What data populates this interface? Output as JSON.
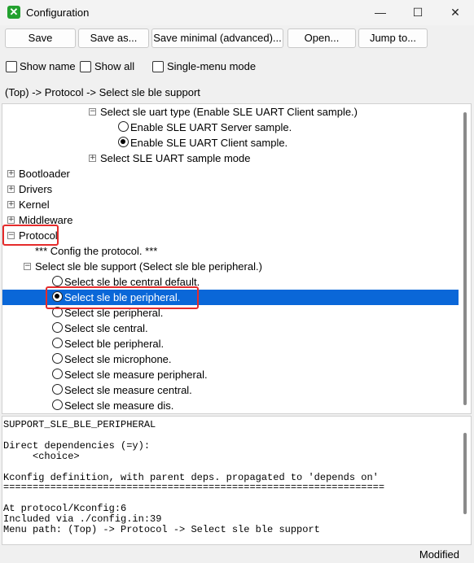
{
  "window": {
    "title": "Configuration",
    "icon": "checkmark-x-icon",
    "minimize": "—",
    "maximize": "☐",
    "close": "✕"
  },
  "toolbar": {
    "save": "Save",
    "save_as": "Save as...",
    "save_minimal": "Save minimal (advanced)...",
    "open": "Open...",
    "jump_to": "Jump to..."
  },
  "options": {
    "show_name": "Show name",
    "show_all": "Show all",
    "single_menu": "Single-menu mode"
  },
  "breadcrumb": "(Top) -> Protocol -> Select sle ble support",
  "tree": [
    {
      "label": "Select sle uart type (Enable SLE UART Client sample.)",
      "kind": "expander",
      "expanded": true
    },
    {
      "label": "Enable SLE UART Server sample.",
      "kind": "radio",
      "checked": false
    },
    {
      "label": "Enable SLE UART Client sample.",
      "kind": "radio",
      "checked": true
    },
    {
      "label": "Select SLE UART sample mode",
      "kind": "expander",
      "expanded": false
    },
    {
      "label": "Bootloader",
      "kind": "expander",
      "expanded": false
    },
    {
      "label": "Drivers",
      "kind": "expander",
      "expanded": false
    },
    {
      "label": "Kernel",
      "kind": "expander",
      "expanded": false
    },
    {
      "label": "Middleware",
      "kind": "expander",
      "expanded": false
    },
    {
      "label": "Protocol",
      "kind": "expander",
      "expanded": true
    },
    {
      "label": "*** Config the protocol. ***",
      "kind": "comment"
    },
    {
      "label": "Select sle ble support (Select sle ble peripheral.)",
      "kind": "expander",
      "expanded": true
    },
    {
      "label": "Select sle ble central default.",
      "kind": "radio",
      "checked": false
    },
    {
      "label": "Select sle ble peripheral.",
      "kind": "radio",
      "checked": true,
      "selected": true
    },
    {
      "label": "Select sle peripheral.",
      "kind": "radio",
      "checked": false
    },
    {
      "label": "Select sle central.",
      "kind": "radio",
      "checked": false
    },
    {
      "label": "Select ble peripheral.",
      "kind": "radio",
      "checked": false
    },
    {
      "label": "Select sle microphone.",
      "kind": "radio",
      "checked": false
    },
    {
      "label": "Select sle measure peripheral.",
      "kind": "radio",
      "checked": false
    },
    {
      "label": "Select sle measure central.",
      "kind": "radio",
      "checked": false
    },
    {
      "label": "Select sle measure dis.",
      "kind": "radio",
      "checked": false
    }
  ],
  "info_lines": [
    "SUPPORT_SLE_BLE_PERIPHERAL",
    "",
    "Direct dependencies (=y):",
    "     <choice>",
    "",
    "Kconfig definition, with parent deps. propagated to 'depends on'",
    "=================================================================",
    "",
    "At protocol/Kconfig:6",
    "Included via ./config.in:39",
    "Menu path: (Top) -> Protocol -> Select sle ble support"
  ],
  "status": "Modified",
  "colors": {
    "selection": "#0a67d8",
    "highlight_box": "#e52b2b"
  }
}
